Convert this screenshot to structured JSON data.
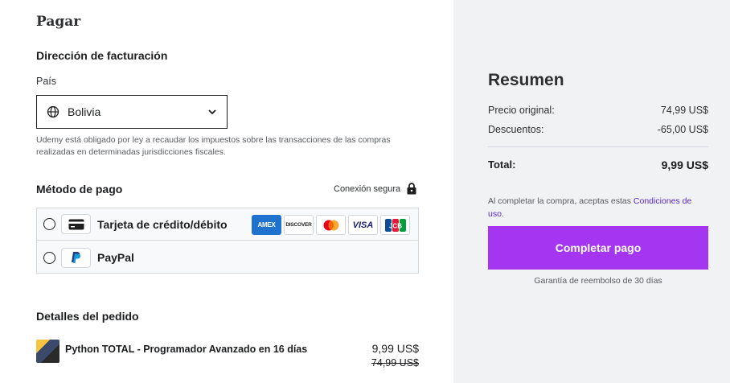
{
  "checkout": {
    "title": "Pagar",
    "billing": {
      "heading": "Dirección de facturación",
      "country_label": "País",
      "country_value": "Bolivia",
      "tax_note": "Udemy está obligado por ley a recaudar los impuestos sobre las transacciones de las compras realizadas en determinadas jurisdicciones fiscales."
    },
    "payment": {
      "heading": "Método de pago",
      "secure_label": "Conexión segura",
      "methods": [
        {
          "label": "Tarjeta de crédito/débito",
          "icon": "credit-card-icon",
          "selected": false
        },
        {
          "label": "PayPal",
          "icon": "paypal-icon",
          "selected": false
        }
      ],
      "card_brands": {
        "amex": "AMEX",
        "discover": "DISCOVER",
        "mastercard": "mastercard-logo",
        "visa": "VISA",
        "jcb": "JCB"
      }
    },
    "order": {
      "heading": "Detalles del pedido",
      "items": [
        {
          "title": "Python TOTAL - Programador Avanzado en 16 días",
          "price": "9,99 US$",
          "original_price": "74,99 US$"
        }
      ]
    }
  },
  "summary": {
    "title": "Resumen",
    "original_label": "Precio original:",
    "original_value": "74,99 US$",
    "discount_label": "Descuentos:",
    "discount_value": "-65,00 US$",
    "total_label": "Total:",
    "total_value": "9,99 US$",
    "terms_text": "Al completar la compra, aceptas estas ",
    "terms_link": "Condiciones de uso",
    "terms_end": ".",
    "cta_label": "Completar pago",
    "guarantee": "Garantía de reembolso de 30 días"
  },
  "colors": {
    "accent": "#a435f0",
    "link": "#5624d0",
    "summary_bg": "#f1f2f4"
  }
}
